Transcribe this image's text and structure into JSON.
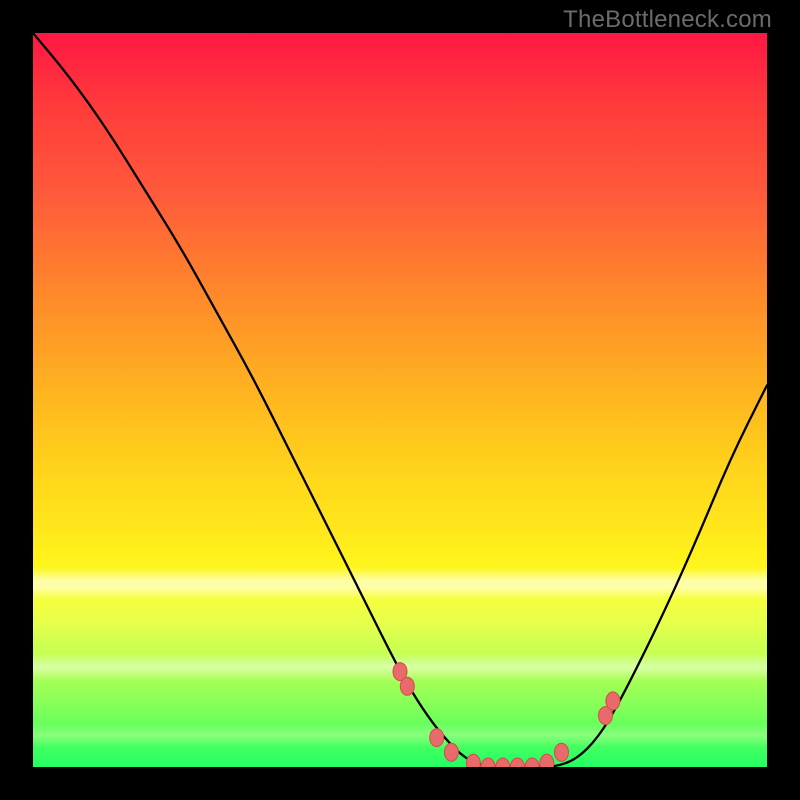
{
  "watermark": "TheBottleneck.com",
  "colors": {
    "curve": "#000000",
    "marker_fill": "#e86a6a",
    "marker_stroke": "#d44a4a",
    "gradient_top": "#ff1744",
    "gradient_bottom": "#23ff64",
    "frame": "#000000"
  },
  "chart_data": {
    "type": "line",
    "title": "",
    "xlabel": "",
    "ylabel": "",
    "xlim": [
      0,
      100
    ],
    "ylim": [
      0,
      100
    ],
    "grid": false,
    "legend": false,
    "series": [
      {
        "name": "bottleneck-curve",
        "x": [
          0,
          5,
          10,
          15,
          20,
          25,
          30,
          35,
          40,
          45,
          50,
          53,
          56,
          59,
          62,
          65,
          68,
          71,
          74,
          77,
          80,
          85,
          90,
          95,
          100
        ],
        "y": [
          100,
          94,
          87,
          79,
          71,
          62,
          53,
          43,
          33,
          23,
          13,
          8,
          4,
          1,
          0,
          0,
          0,
          0,
          1,
          4,
          9,
          19,
          30,
          42,
          52
        ]
      }
    ],
    "markers": {
      "name": "highlighted-points",
      "x": [
        50,
        51,
        55,
        57,
        60,
        62,
        64,
        66,
        68,
        70,
        72,
        78,
        79
      ],
      "y": [
        13,
        11,
        4,
        2,
        0.5,
        0,
        0,
        0,
        0,
        0.5,
        2,
        7,
        9
      ]
    }
  }
}
